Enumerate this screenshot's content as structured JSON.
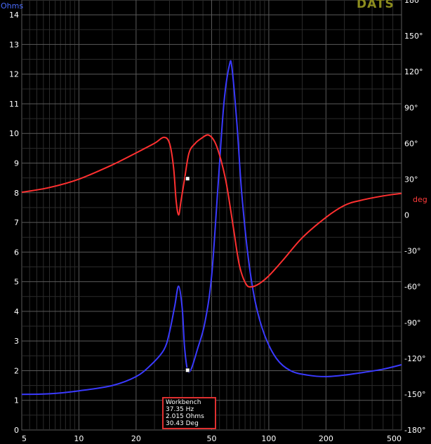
{
  "brand": "DATS",
  "chart_data": {
    "type": "line",
    "x_scale": "log",
    "xlim": [
      5,
      500
    ],
    "x_ticks": [
      5,
      10,
      20,
      50,
      100,
      200,
      500
    ],
    "ylim_left": [
      0,
      14.5
    ],
    "ylim_right": [
      -180,
      180
    ],
    "y_left_ticks": [
      0,
      1,
      2,
      3,
      4,
      5,
      6,
      7,
      8,
      9,
      10,
      11,
      12,
      13,
      14
    ],
    "y_right_ticks": [
      -180,
      -150,
      -120,
      -90,
      -60,
      -30,
      0,
      30,
      60,
      90,
      120,
      150,
      180
    ],
    "y_right_tick_labels": [
      "-180°",
      "-150°",
      "-120°",
      "-90°",
      "-60°",
      "-30°",
      "0",
      "30°",
      "60°",
      "90°",
      "120°",
      "150°",
      "180°"
    ],
    "ylabel_left": "Ohms",
    "ylabel_right": "deg",
    "grid": true,
    "series": [
      {
        "axis": "left",
        "color": "#3a3aff",
        "points": [
          [
            5,
            1.2
          ],
          [
            7,
            1.22
          ],
          [
            10,
            1.32
          ],
          [
            15,
            1.5
          ],
          [
            20,
            1.8
          ],
          [
            24,
            2.2
          ],
          [
            28,
            2.7
          ],
          [
            30,
            3.3
          ],
          [
            32,
            4.2
          ],
          [
            33.5,
            4.85
          ],
          [
            35,
            4.1
          ],
          [
            36,
            2.8
          ],
          [
            37.35,
            2.015
          ],
          [
            39,
            2.05
          ],
          [
            42,
            2.7
          ],
          [
            46,
            3.6
          ],
          [
            50,
            5.2
          ],
          [
            54,
            8.2
          ],
          [
            58,
            11.0
          ],
          [
            62,
            12.3
          ],
          [
            64,
            12.2
          ],
          [
            68,
            10.3
          ],
          [
            72,
            8.0
          ],
          [
            78,
            5.8
          ],
          [
            85,
            4.3
          ],
          [
            95,
            3.2
          ],
          [
            110,
            2.4
          ],
          [
            130,
            2.0
          ],
          [
            160,
            1.85
          ],
          [
            200,
            1.8
          ],
          [
            250,
            1.85
          ],
          [
            300,
            1.92
          ],
          [
            400,
            2.05
          ],
          [
            500,
            2.2
          ]
        ]
      },
      {
        "axis": "right",
        "color": "#ff3030",
        "points": [
          [
            5,
            19
          ],
          [
            7,
            23
          ],
          [
            10,
            30
          ],
          [
            15,
            42
          ],
          [
            20,
            52
          ],
          [
            25,
            60
          ],
          [
            28,
            65
          ],
          [
            30,
            60
          ],
          [
            31.5,
            40
          ],
          [
            32.5,
            12
          ],
          [
            33.5,
            0
          ],
          [
            34.5,
            12
          ],
          [
            36,
            30
          ],
          [
            38,
            52
          ],
          [
            41,
            60
          ],
          [
            44,
            64
          ],
          [
            48,
            67
          ],
          [
            52,
            61
          ],
          [
            56,
            46
          ],
          [
            60,
            25
          ],
          [
            65,
            -10
          ],
          [
            70,
            -42
          ],
          [
            76,
            -58
          ],
          [
            82,
            -60
          ],
          [
            90,
            -57
          ],
          [
            100,
            -51
          ],
          [
            120,
            -37
          ],
          [
            150,
            -19
          ],
          [
            200,
            -2
          ],
          [
            250,
            8
          ],
          [
            300,
            12
          ],
          [
            400,
            16
          ],
          [
            500,
            18
          ]
        ]
      }
    ],
    "markers": [
      {
        "axis": "left",
        "x": 37.35,
        "y": 2.015
      },
      {
        "axis": "right",
        "x": 37.35,
        "y": 30.43
      }
    ]
  },
  "readout": {
    "title": "Workbench",
    "freq": "37.35 Hz",
    "impedance": "2.015 Ohms",
    "phase": "30.43 Deg"
  },
  "colors": {
    "background": "#000000",
    "grid_minor": "#2b2b2b",
    "grid_major": "#5a5a5a",
    "tick_text": "#ffffff",
    "readout_border": "#e03030"
  }
}
